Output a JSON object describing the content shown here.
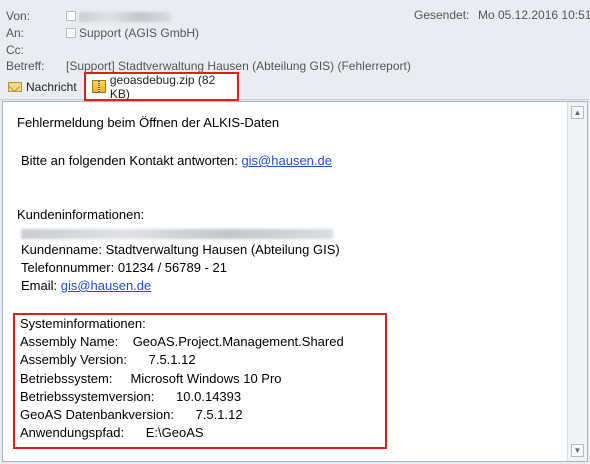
{
  "header": {
    "from_label": "Von:",
    "to_label": "An:",
    "cc_label": "Cc:",
    "subject_label": "Betreff:",
    "to_value": "Support (AGIS GmbH)",
    "subject_value": "[Support] Stadtverwaltung Hausen (Abteilung GIS) (Fehlerreport)",
    "sent_label": "Gesendet:",
    "sent_value": "Mo 05.12.2016 10:51"
  },
  "attachments": {
    "message_tab": "Nachricht",
    "file": "geoasdebug.zip (82 KB)"
  },
  "body": {
    "line1": "Fehlermeldung beim Öffnen der ALKIS-Daten",
    "reply_prefix": "Bitte an folgenden Kontakt antworten: ",
    "reply_email": "gis@hausen.de",
    "customer_heading": "Kundeninformationen:",
    "customer_name": "Kundenname: Stadtverwaltung Hausen (Abteilung GIS)",
    "phone": "Telefonnummer: 01234 / 56789 - 21",
    "email_prefix": "Email: ",
    "email": "gis@hausen.de",
    "sys_heading": "Systeminformationen:",
    "assembly_name": "Assembly Name:    GeoAS.Project.Management.Shared",
    "assembly_version": "Assembly Version:      7.5.1.12",
    "os": "Betriebssystem:     Microsoft Windows 10 Pro",
    "os_version": "Betriebssystemversion:      10.0.14393",
    "db_version": "GeoAS Datenbankversion:      7.5.1.12",
    "app_path": "Anwendungspfad:      E:\\GeoAS"
  },
  "icons": {
    "message": "envelope-icon",
    "attachment": "zip-file-icon",
    "recipient": "contact-checkbox-icon"
  },
  "colors": {
    "highlight_border": "#e01e1e",
    "link": "#1b4fd6"
  }
}
